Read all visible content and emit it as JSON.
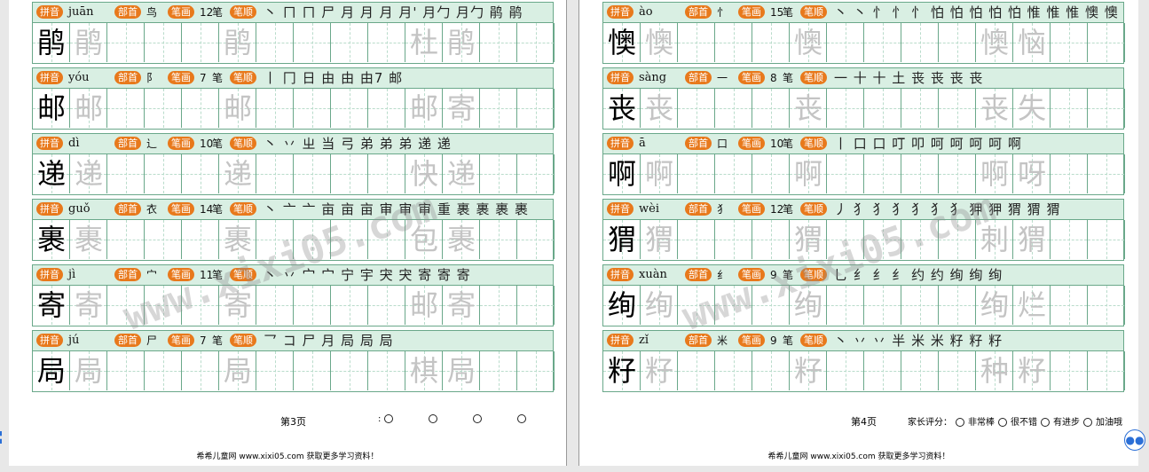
{
  "labels": {
    "pinyin": "拼音",
    "radical": "部首",
    "strokes": "笔画",
    "order": "笔顺",
    "strokes_unit": "笔"
  },
  "pages": [
    {
      "page_label": "第3页",
      "parent_colon": ":",
      "footer": "希希儿童网 www.xixi05.com 获取更多学习资料！",
      "cards": [
        {
          "char": "鹃",
          "pinyin": "juān",
          "radical": "鸟",
          "strokes": "12",
          "order": "丶 ㄇ ㄇ 尸 月 月 月 月' 月勹 月勹 鹃 鹃",
          "words": [
            "鹃",
            "",
            "鹃"
          ],
          "extra": [
            "杜",
            "鹃"
          ]
        },
        {
          "char": "邮",
          "pinyin": "yóu",
          "radical": "阝",
          "strokes": "7",
          "order": "丨 冂 日 由 由 由7 邮",
          "words": [
            "邮",
            "",
            "邮"
          ],
          "extra": [
            "邮",
            "寄"
          ]
        },
        {
          "char": "递",
          "pinyin": "dì",
          "radical": "辶",
          "strokes": "10",
          "order": "丶 丷 ㄓ 当 弓 弟 弟 弟 递 递",
          "words": [
            "递",
            "",
            "递"
          ],
          "extra": [
            "快",
            "递"
          ]
        },
        {
          "char": "裹",
          "pinyin": "guǒ",
          "radical": "衣",
          "strokes": "14",
          "order": "丶 亠 亠 亩 亩 亩 审 审 审 重 裹 裹 裹 裹",
          "words": [
            "裹",
            "",
            "裹"
          ],
          "extra": [
            "包",
            "裹"
          ]
        },
        {
          "char": "寄",
          "pinyin": "jì",
          "radical": "宀",
          "strokes": "11",
          "order": "丶 丷 宀 宀 宁 宇 宊 宊 寄 寄 寄",
          "words": [
            "寄",
            "",
            "寄"
          ],
          "extra": [
            "邮",
            "寄"
          ]
        },
        {
          "char": "局",
          "pinyin": "jú",
          "radical": "尸",
          "strokes": "7",
          "order": "乛 コ 尸 月 局 局 局",
          "words": [
            "局",
            "",
            "局"
          ],
          "extra": [
            "棋",
            "局"
          ]
        }
      ]
    },
    {
      "page_label": "第4页",
      "parent_title": "家长评分：",
      "ratings": [
        "非常棒",
        "很不错",
        "有进步",
        "加油哦"
      ],
      "footer": "希希儿童网 www.xixi05.com 获取更多学习资料！",
      "cards": [
        {
          "char": "懊",
          "pinyin": "ào",
          "radical": "忄",
          "strokes": "15",
          "order": "丶 丶 忄 忄 忄 怕 怕 怕 怕 怕 惟 惟 惟 懊 懊",
          "words": [
            "懊",
            "",
            "懊"
          ],
          "extra": [
            "懊",
            "恼"
          ]
        },
        {
          "char": "丧",
          "pinyin": "sàng",
          "radical": "一",
          "strokes": "8",
          "order": "一 十 ⼗ 土 丧 丧 丧 丧",
          "words": [
            "丧",
            "",
            "丧"
          ],
          "extra": [
            "丧",
            "失"
          ]
        },
        {
          "char": "啊",
          "pinyin": "ā",
          "radical": "口",
          "strokes": "10",
          "order": "丨 口 口 叮 叩 呵 呵 呵 呵 啊",
          "words": [
            "啊",
            "",
            "啊"
          ],
          "extra": [
            "啊",
            "呀"
          ]
        },
        {
          "char": "猬",
          "pinyin": "wèi",
          "radical": "犭",
          "strokes": "12",
          "order": "丿 犭 犭 犭 犭 犭 犭 狎 狎 猬 猬 猬",
          "words": [
            "猬",
            "",
            "猬"
          ],
          "extra": [
            "刺",
            "猬"
          ]
        },
        {
          "char": "绚",
          "pinyin": "xuàn",
          "radical": "纟",
          "strokes": "9",
          "order": "乚 纟 纟 纟 约 约 绚 绚 绚",
          "words": [
            "绚",
            "",
            "绚"
          ],
          "extra": [
            "绚",
            "烂"
          ]
        },
        {
          "char": "籽",
          "pinyin": "zǐ",
          "radical": "米",
          "strokes": "9",
          "order": "丶 丷 丷 半 米 米 籽 籽 籽",
          "words": [
            "籽",
            "",
            "籽"
          ],
          "extra": [
            "种",
            "籽"
          ]
        }
      ]
    }
  ],
  "watermark": "www.xixi05.com"
}
